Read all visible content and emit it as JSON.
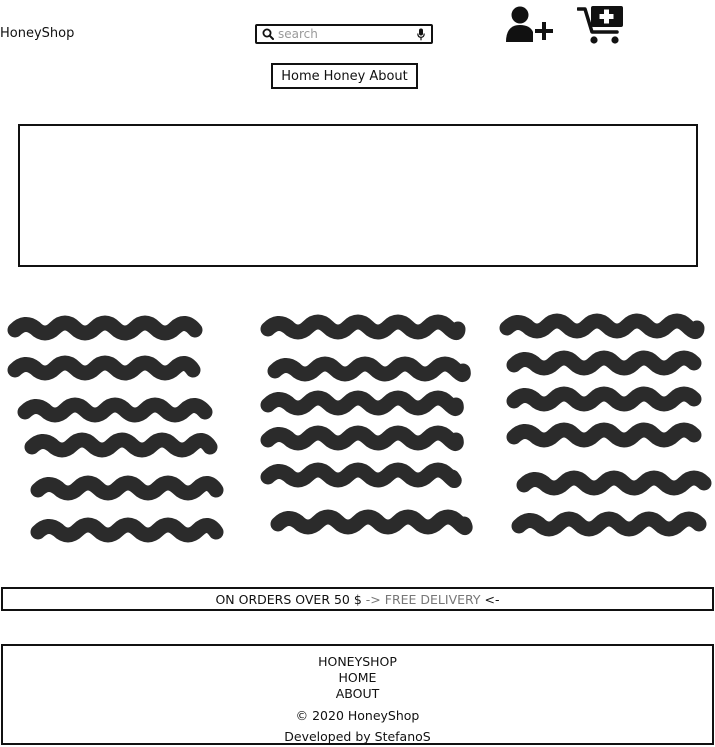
{
  "header": {
    "logo": "HoneyShop",
    "search": {
      "placeholder": "search",
      "value": ""
    },
    "icons": [
      "search-icon",
      "microphone-icon",
      "add-user-icon",
      "add-to-cart-icon"
    ]
  },
  "nav": {
    "items": [
      "Home",
      "Honey",
      "About"
    ]
  },
  "banner": {
    "prefix": "ON ORDERS OVER 50 $",
    "arrow_left": " -> ",
    "highlight": "FREE DELIVERY",
    "arrow_right": " <-"
  },
  "footer": {
    "brand": "HONEYSHOP",
    "links": [
      "HOME",
      "ABOUT"
    ],
    "copyright": "© 2020 HoneyShop",
    "developer": "Developed by StefanoS"
  },
  "colors": {
    "ink": "#111111",
    "muted": "#777777",
    "placeholder": "#9a9a9a"
  }
}
